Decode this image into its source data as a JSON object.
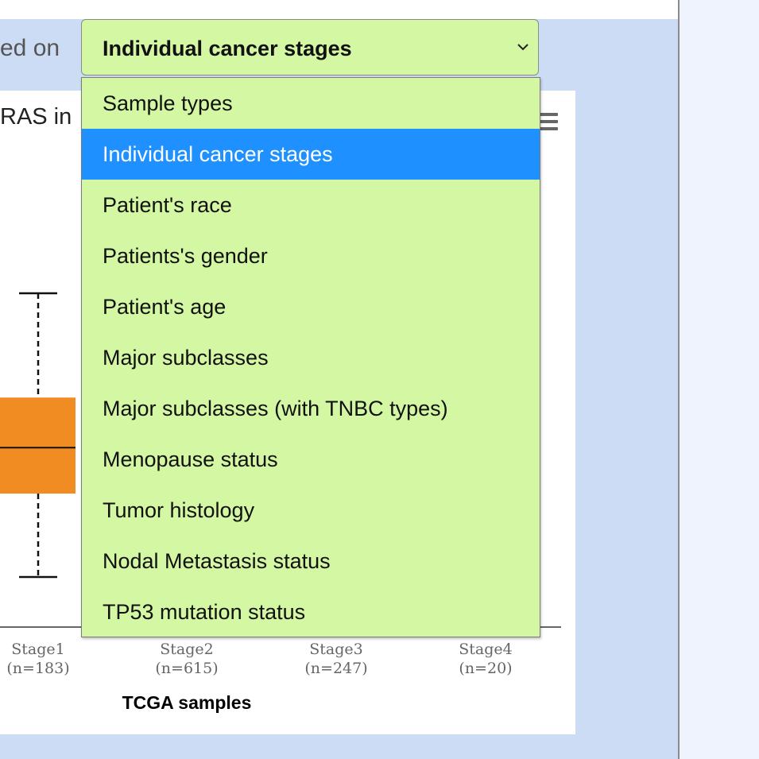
{
  "header": {
    "based_on_label": "ed on",
    "select_value": "Individual cancer stages"
  },
  "dropdown": {
    "options": [
      "Sample types",
      "Individual cancer stages",
      "Patient's race",
      "Patients's gender",
      "Patient's age",
      "Major subclasses",
      "Major subclasses (with TNBC types)",
      "Menopause status",
      "Tumor histology",
      "Nodal Metastasis status",
      "TP53 mutation status"
    ],
    "selected_index": 1,
    "bg_color": "#d4f7a3",
    "highlight_color": "#1e90ff"
  },
  "chart": {
    "title_fragment": "RAS in",
    "menu_icon": "hamburger-menu-icon"
  },
  "chart_data": {
    "type": "box",
    "xlabel": "TCGA samples",
    "categories": [
      {
        "name": "Stage1",
        "count_label": "(n=183)"
      },
      {
        "name": "Stage2",
        "count_label": "(n=615)"
      },
      {
        "name": "Stage3",
        "count_label": "(n=247)"
      },
      {
        "name": "Stage4",
        "count_label": "(n=20)"
      }
    ],
    "box_color": "#f08c22",
    "visible_box": {
      "category": "Stage1",
      "whisker_max": 0.8,
      "q3": 0.55,
      "median": 0.43,
      "q1": 0.32,
      "whisker_min": 0.12
    },
    "ylim": [
      0,
      1
    ]
  }
}
